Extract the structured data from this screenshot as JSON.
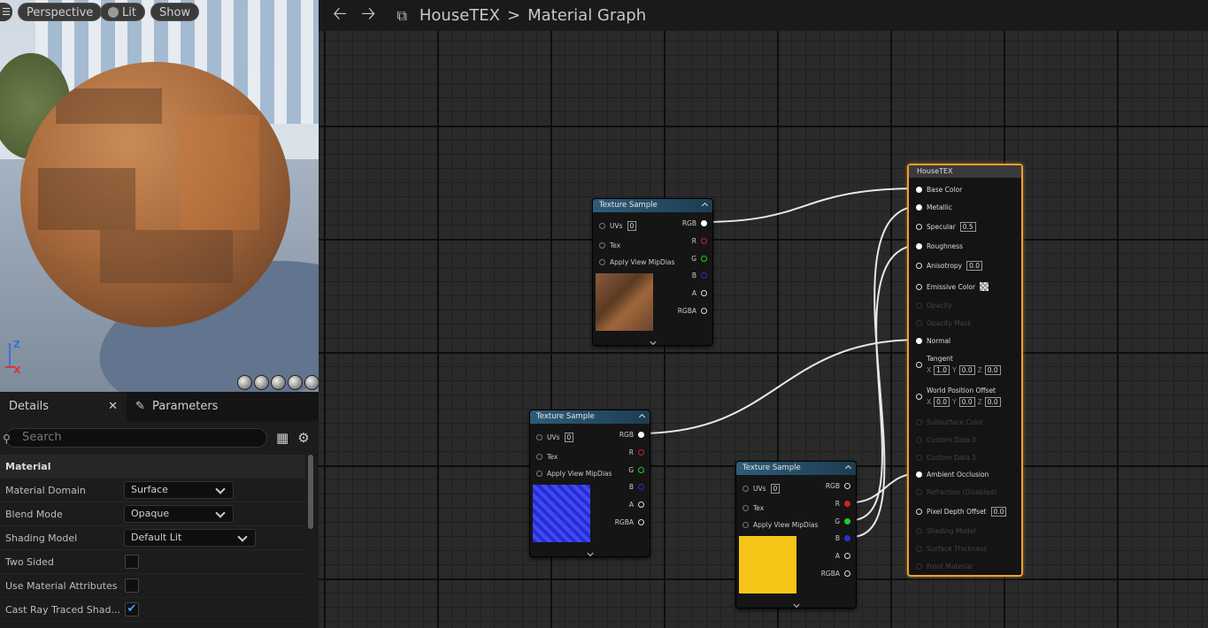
{
  "viewport": {
    "menu_icon": "hamburger-icon",
    "perspective_label": "Perspective",
    "lit_label": "Lit",
    "show_label": "Show",
    "axis_z": "Z",
    "axis_x": "X"
  },
  "details": {
    "tabs": [
      {
        "label": "Details"
      },
      {
        "label": "Parameters"
      }
    ],
    "search_placeholder": "Search",
    "section_title": "Material",
    "rows": [
      {
        "label": "Material Domain",
        "value": "Surface"
      },
      {
        "label": "Blend Mode",
        "value": "Opaque"
      },
      {
        "label": "Shading Model",
        "value": "Default Lit"
      },
      {
        "label": "Two Sided",
        "checked": false
      },
      {
        "label": "Use Material Attributes",
        "checked": false
      },
      {
        "label": "Cast Ray Traced Shad...",
        "checked": true
      }
    ]
  },
  "toolbar": {
    "breadcrumb_root": "HouseTEX",
    "breadcrumb_sep": ">",
    "breadcrumb_current": "Material Graph"
  },
  "texture_node": {
    "title": "Texture Sample",
    "uvs_label": "UVs",
    "uvs_value": "0",
    "tex_label": "Tex",
    "mip_label": "Apply View MipDias",
    "outputs": [
      "RGB",
      "R",
      "G",
      "B",
      "A",
      "RGBA"
    ],
    "colors": {
      "R": "#cc2222",
      "G": "#22cc22",
      "B": "#2233cc"
    }
  },
  "result_node": {
    "title": "HouseTEX",
    "pins": [
      {
        "label": "Base Color"
      },
      {
        "label": "Metallic"
      },
      {
        "label": "Specular",
        "value": "0.5"
      },
      {
        "label": "Roughness"
      },
      {
        "label": "Anisotropy",
        "value": "0.0"
      },
      {
        "label": "Emissive Color"
      },
      {
        "label": "Opacity"
      },
      {
        "label": "Opacity Mask"
      },
      {
        "label": "Normal"
      },
      {
        "label": "Tangent",
        "x": "1.0",
        "y": "0.0",
        "z": "0.0"
      },
      {
        "label": "World Position Offset",
        "x": "0.0",
        "y": "0.0",
        "z": "0.0"
      },
      {
        "label": "Subsurface Color"
      },
      {
        "label": "Custom Data 0"
      },
      {
        "label": "Custom Data 1"
      },
      {
        "label": "Ambient Occlusion"
      },
      {
        "label": "Refraction (Disabled)"
      },
      {
        "label": "Pixel Depth Offset",
        "value": "0.0"
      },
      {
        "label": "Shading Model"
      },
      {
        "label": "Surface Thickness"
      },
      {
        "label": "Front Material"
      }
    ],
    "comp_x": "X",
    "comp_y": "Y",
    "comp_z": "Z"
  },
  "accent": "#f0a030"
}
